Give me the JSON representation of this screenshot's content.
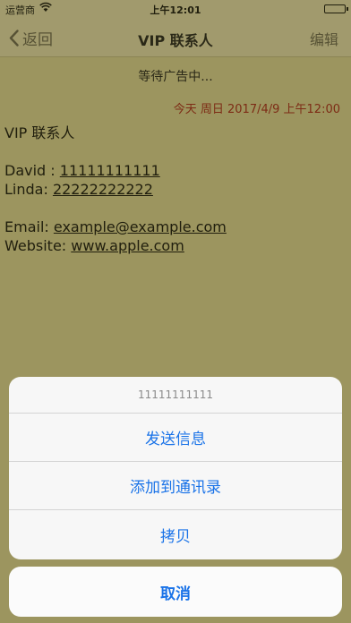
{
  "status_bar": {
    "carrier": "运营商",
    "time": "上午12:01"
  },
  "nav": {
    "back_label": "返回",
    "title": "VIP 联系人",
    "edit_label": "编辑"
  },
  "content": {
    "ad_text": "等待广告中...",
    "timestamp": "今天 周日  2017/4/9 上午12:00",
    "heading": "VIP 联系人",
    "contact_1_name": "David : ",
    "contact_1_phone": "11111111111",
    "contact_2_name": "Linda:  ",
    "contact_2_phone": "22222222222",
    "email_label": "Email: ",
    "email_value": "example@example.com",
    "website_label": "Website: ",
    "website_value": "www.apple.com"
  },
  "action_sheet": {
    "header": "11111111111",
    "actions": [
      {
        "label": "发送信息"
      },
      {
        "label": "添加到通讯录"
      },
      {
        "label": "拷贝"
      }
    ],
    "cancel_label": "取消"
  },
  "colors": {
    "page_background": "#e5dc9d",
    "bar_background": "#eee6b6",
    "timestamp_red": "#b0281e",
    "action_blue": "#1a73e8"
  },
  "icons": [
    "wifi-icon",
    "battery-icon",
    "back-chevron-icon"
  ]
}
